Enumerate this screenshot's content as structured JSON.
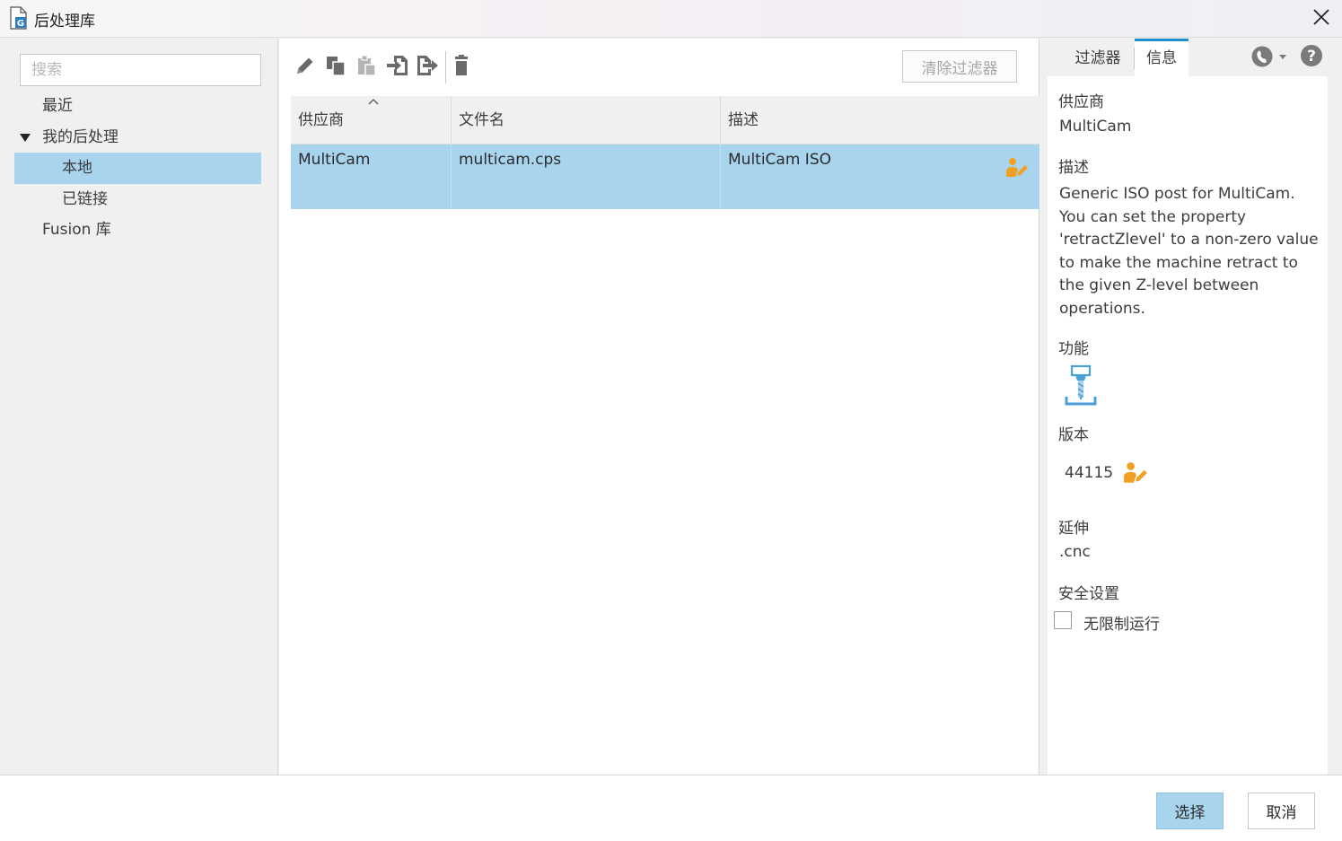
{
  "window": {
    "title": "后处理库",
    "app_icon": "post-library-file-icon",
    "close_icon": "close-icon"
  },
  "left_pane": {
    "search_placeholder": "搜索",
    "tree": [
      {
        "label": "最近",
        "level": 0,
        "expanded": null,
        "selected": false
      },
      {
        "label": "我的后处理",
        "level": 0,
        "expanded": true,
        "selected": false
      },
      {
        "label": "本地",
        "level": 1,
        "expanded": null,
        "selected": true
      },
      {
        "label": "已链接",
        "level": 1,
        "expanded": null,
        "selected": false
      },
      {
        "label": "Fusion 库",
        "level": 0,
        "expanded": null,
        "selected": false
      }
    ]
  },
  "toolbar": {
    "icons": [
      "edit-pencil-icon",
      "copy-icon",
      "paste-icon",
      "import-icon",
      "export-icon",
      "delete-trash-icon"
    ],
    "clear_filter_label": "清除过滤器"
  },
  "table": {
    "columns": [
      "供应商",
      "文件名",
      "描述"
    ],
    "sort_column": "供应商",
    "sort_direction": "ascending",
    "rows": [
      {
        "vendor": "MultiCam",
        "filename": "multicam.cps",
        "description": "MultiCam ISO",
        "selected": true,
        "status_icon": "user-edit-icon"
      }
    ]
  },
  "right_pane": {
    "tabs": [
      {
        "label": "过滤器",
        "active": false
      },
      {
        "label": "信息",
        "active": true
      }
    ],
    "header_icons": [
      "support-phone-icon",
      "help-icon"
    ],
    "info": {
      "vendor_label": "供应商",
      "vendor_value": "MultiCam",
      "description_label": "描述",
      "description_value": "Generic ISO post for MultiCam. You can set the property 'retractZlevel' to a non-zero value to make the machine retract to the given Z-level between operations.",
      "capability_label": "功能",
      "capability_icon": "milling-capability-icon",
      "version_label": "版本",
      "version_value": "44115",
      "extension_label": "延伸",
      "extension_value": ".cnc",
      "security_label": "安全设置",
      "unrestricted_label": "无限制运行",
      "unrestricted_checked": false
    }
  },
  "footer": {
    "select_label": "选择",
    "cancel_label": "取消"
  },
  "colors": {
    "selection": "#a8d4ee",
    "tab_accent": "#1c8fd0",
    "user_icon": "#f2a024",
    "capability_icon": "#4a9fd8"
  }
}
